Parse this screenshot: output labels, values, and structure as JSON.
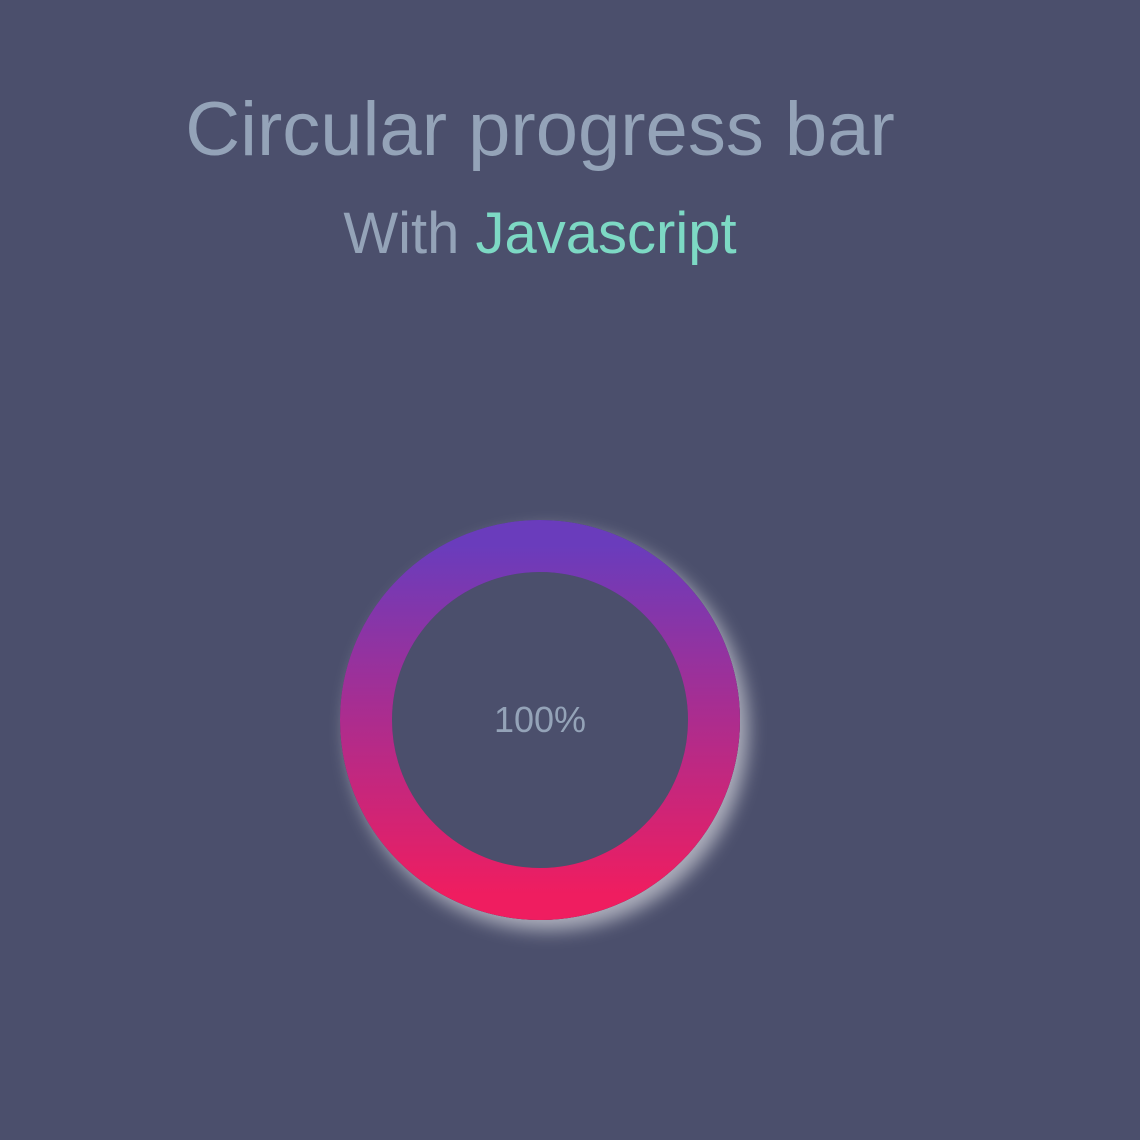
{
  "header": {
    "title": "Circular progress bar",
    "subtitle_prefix": "With",
    "subtitle_accent": "Javascript"
  },
  "progress": {
    "value": 100,
    "label": "100%",
    "gradient_start": "#ef1d60",
    "gradient_end": "#6a3cbc",
    "track_color": "#3f4360"
  },
  "colors": {
    "background": "#4b4f6c",
    "text_muted": "#94a3b8",
    "accent": "#7dd9c4"
  }
}
